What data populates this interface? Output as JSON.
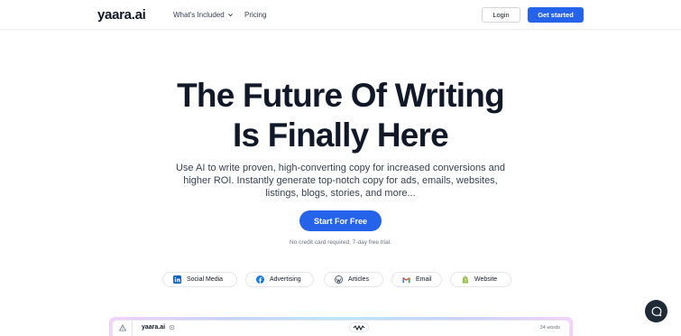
{
  "header": {
    "logo": "yaara.ai",
    "nav": [
      {
        "label": "What's Included",
        "has_dropdown": true
      },
      {
        "label": "Pricing",
        "has_dropdown": false
      }
    ],
    "login_label": "Login",
    "get_started_label": "Get started"
  },
  "hero": {
    "title_line1": "The Future Of Writing",
    "title_line2": "Is Finally Here",
    "subtitle": "Use AI to write proven, high-converting copy for increased conversions and higher ROI. Instantly generate top-notch copy for ads, emails, websites, listings, blogs, stories, and more...",
    "cta_label": "Start For Free",
    "cta_note": "No credit card required. 7-day free trial."
  },
  "categories": [
    {
      "label": "Social Media",
      "icon": "linkedin-icon"
    },
    {
      "label": "Advertising",
      "icon": "facebook-icon"
    },
    {
      "label": "Articles",
      "icon": "wordpress-icon"
    },
    {
      "label": "Email",
      "icon": "gmail-icon"
    },
    {
      "label": "Website",
      "icon": "shopify-icon"
    }
  ],
  "preview": {
    "logo": "yaara.ai",
    "word_count": "34 words",
    "icons": [
      "warning-icon",
      "sparkle-icon",
      "wave-icon"
    ]
  },
  "chat": {
    "icon": "chat-bubble-icon"
  },
  "colors": {
    "primary": "#2563eb",
    "text": "#111827",
    "muted": "#6b7280",
    "chat_bg": "#1f2a37"
  }
}
